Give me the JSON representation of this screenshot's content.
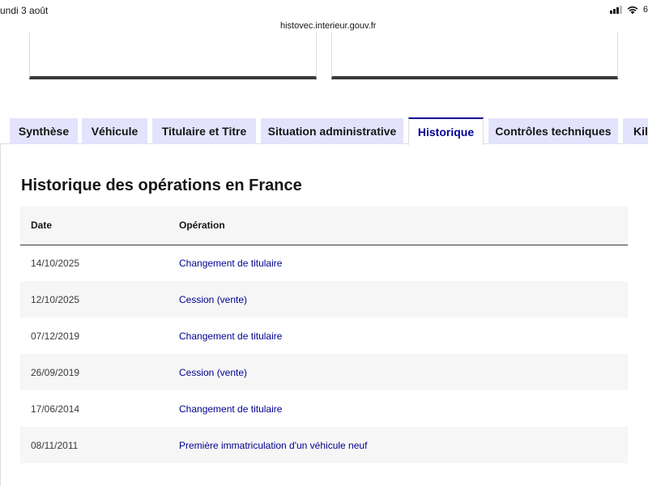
{
  "status_bar": {
    "date": "undi 3 août",
    "battery": "6"
  },
  "browser": {
    "url": "histovec.interieur.gouv.fr"
  },
  "tabs": [
    {
      "label": "Synthèse",
      "active": false
    },
    {
      "label": "Véhicule",
      "active": false
    },
    {
      "label": "Titulaire et Titre",
      "active": false
    },
    {
      "label": "Situation administrative",
      "active": false
    },
    {
      "label": "Historique",
      "active": true
    },
    {
      "label": "Contrôles techniques",
      "active": false
    },
    {
      "label": "Kil",
      "active": false
    }
  ],
  "section": {
    "title": "Historique des opérations en France"
  },
  "table": {
    "headers": {
      "date": "Date",
      "operation": "Opération"
    },
    "rows": [
      {
        "date": "14/10/2025",
        "operation": "Changement de titulaire"
      },
      {
        "date": "12/10/2025",
        "operation": "Cession (vente)"
      },
      {
        "date": "07/12/2019",
        "operation": "Changement de titulaire"
      },
      {
        "date": "26/09/2019",
        "operation": "Cession (vente)"
      },
      {
        "date": "17/06/2014",
        "operation": "Changement de titulaire"
      },
      {
        "date": "08/11/2011",
        "operation": "Première immatriculation d'un véhicule neuf"
      }
    ]
  },
  "colors": {
    "accent": "#000091",
    "tab_background": "#e3e3fd",
    "row_stripe": "#f6f6f6"
  }
}
